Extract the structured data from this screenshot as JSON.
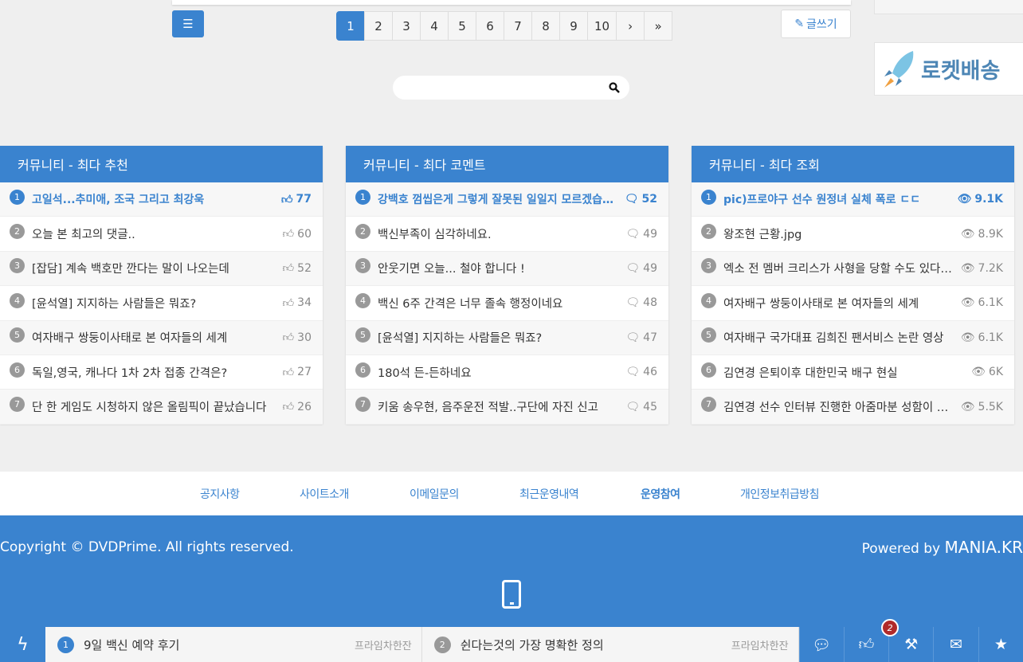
{
  "pagination": {
    "pages": [
      "1",
      "2",
      "3",
      "4",
      "5",
      "6",
      "7",
      "8",
      "9",
      "10"
    ],
    "next": "›",
    "last": "»",
    "current": "1"
  },
  "write_button": "글쓰기",
  "ad": {
    "text": "로켓배송"
  },
  "search": {
    "placeholder": ""
  },
  "panels": [
    {
      "title": "커뮤니티 - 최다 추천",
      "icon": "thumbs-up-icon",
      "items": [
        {
          "n": "1",
          "t": "고일석...추미애, 조국 그리고 최강욱",
          "c": "77"
        },
        {
          "n": "2",
          "t": "오늘 본 최고의 댓글..",
          "c": "60"
        },
        {
          "n": "3",
          "t": "[잡담] 계속 백호만 깐다는 말이 나오는데",
          "c": "52"
        },
        {
          "n": "4",
          "t": "[윤석열] 지지하는 사람들은 뭐죠?",
          "c": "34"
        },
        {
          "n": "5",
          "t": "여자배구 쌍둥이사태로 본 여자들의 세계",
          "c": "30"
        },
        {
          "n": "6",
          "t": "독일,영국, 캐나다 1차 2차 접종 간격은?",
          "c": "27"
        },
        {
          "n": "7",
          "t": "단 한 게임도 시청하지 않은 올림픽이 끝났습니다",
          "c": "26"
        }
      ]
    },
    {
      "title": "커뮤니티 - 최다 코멘트",
      "icon": "comment-icon",
      "items": [
        {
          "n": "1",
          "t": "강백호 껌씹은게 그렇게 잘못된 일일지 모르겠습니다",
          "c": "52"
        },
        {
          "n": "2",
          "t": "백신부족이 심각하네요.",
          "c": "49"
        },
        {
          "n": "3",
          "t": "안웃기면 오늘... 철야 합니다 !",
          "c": "49"
        },
        {
          "n": "4",
          "t": "백신 6주 간격은 너무 졸속 행정이네요",
          "c": "48"
        },
        {
          "n": "5",
          "t": "[윤석열] 지지하는 사람들은 뭐죠?",
          "c": "47"
        },
        {
          "n": "6",
          "t": "180석 든-든하네요",
          "c": "46"
        },
        {
          "n": "7",
          "t": "키움 송우현, 음주운전 적발..구단에 자진 신고",
          "c": "45"
        }
      ]
    },
    {
      "title": "커뮤니티 - 최다 조회",
      "icon": "eye-icon",
      "items": [
        {
          "n": "1",
          "t": "pic)프로야구 선수 원정녀 실체 폭로 ㄷㄷ",
          "c": "9.1K"
        },
        {
          "n": "2",
          "t": "왕조현 근황.jpg",
          "c": "8.9K"
        },
        {
          "n": "3",
          "t": "엑소 전 멤버 크리스가 사형을 당할 수도 있다네요",
          "c": "7.2K"
        },
        {
          "n": "4",
          "t": "여자배구 쌍둥이사태로 본 여자들의 세계",
          "c": "6.1K"
        },
        {
          "n": "5",
          "t": "여자배구 국가대표 김희진 팬서비스 논란 영상",
          "c": "6.1K"
        },
        {
          "n": "6",
          "t": "김연경 은퇴이후 대한민국 배구 현실",
          "c": "6K"
        },
        {
          "n": "7",
          "t": "김연경 선수 인터뷰 진행한 아줌마분 성함이 뭔가요",
          "c": "5.5K"
        }
      ]
    }
  ],
  "footer_links": [
    "공지사항",
    "사이트소개",
    "이메일문의",
    "최근운영내역",
    "운영참여",
    "개인정보취급방침"
  ],
  "copyright": "Copyright © DVDPrime. All rights reserved.",
  "powered_by": "Powered by",
  "powered_brand": "MANIA.KR",
  "ticker": [
    {
      "n": "1",
      "t": "9일 백신 예약 후기",
      "s": "프라임차한잔"
    },
    {
      "n": "2",
      "t": "쉰다는것의 가장 명확한 정의",
      "s": "프라임차한잔"
    }
  ],
  "notification_count": "2",
  "colors": {
    "accent": "#3a83cf",
    "badge": "#b02a2a"
  }
}
